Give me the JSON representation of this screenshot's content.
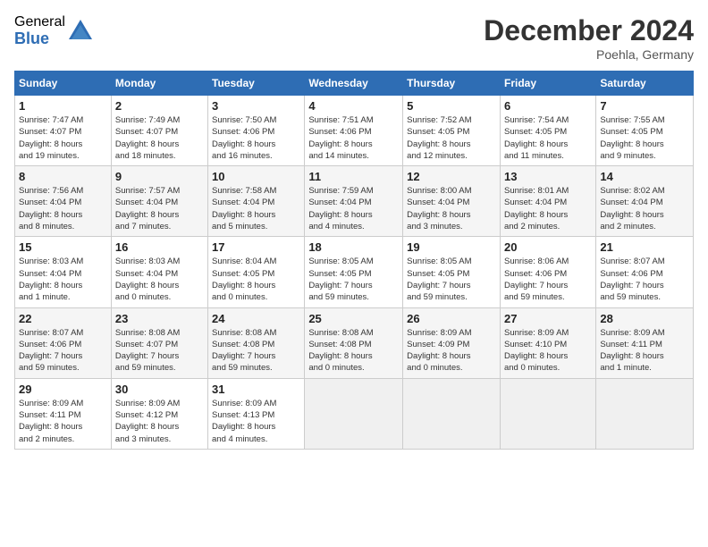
{
  "header": {
    "logo_general": "General",
    "logo_blue": "Blue",
    "month_title": "December 2024",
    "location": "Poehla, Germany"
  },
  "calendar": {
    "days_of_week": [
      "Sunday",
      "Monday",
      "Tuesday",
      "Wednesday",
      "Thursday",
      "Friday",
      "Saturday"
    ],
    "weeks": [
      [
        {
          "day": "1",
          "sunrise": "7:47 AM",
          "sunset": "4:07 PM",
          "daylight": "8 hours and 19 minutes."
        },
        {
          "day": "2",
          "sunrise": "7:49 AM",
          "sunset": "4:07 PM",
          "daylight": "8 hours and 18 minutes."
        },
        {
          "day": "3",
          "sunrise": "7:50 AM",
          "sunset": "4:06 PM",
          "daylight": "8 hours and 16 minutes."
        },
        {
          "day": "4",
          "sunrise": "7:51 AM",
          "sunset": "4:06 PM",
          "daylight": "8 hours and 14 minutes."
        },
        {
          "day": "5",
          "sunrise": "7:52 AM",
          "sunset": "4:05 PM",
          "daylight": "8 hours and 12 minutes."
        },
        {
          "day": "6",
          "sunrise": "7:54 AM",
          "sunset": "4:05 PM",
          "daylight": "8 hours and 11 minutes."
        },
        {
          "day": "7",
          "sunrise": "7:55 AM",
          "sunset": "4:05 PM",
          "daylight": "8 hours and 9 minutes."
        }
      ],
      [
        {
          "day": "8",
          "sunrise": "7:56 AM",
          "sunset": "4:04 PM",
          "daylight": "8 hours and 8 minutes."
        },
        {
          "day": "9",
          "sunrise": "7:57 AM",
          "sunset": "4:04 PM",
          "daylight": "8 hours and 7 minutes."
        },
        {
          "day": "10",
          "sunrise": "7:58 AM",
          "sunset": "4:04 PM",
          "daylight": "8 hours and 5 minutes."
        },
        {
          "day": "11",
          "sunrise": "7:59 AM",
          "sunset": "4:04 PM",
          "daylight": "8 hours and 4 minutes."
        },
        {
          "day": "12",
          "sunrise": "8:00 AM",
          "sunset": "4:04 PM",
          "daylight": "8 hours and 3 minutes."
        },
        {
          "day": "13",
          "sunrise": "8:01 AM",
          "sunset": "4:04 PM",
          "daylight": "8 hours and 2 minutes."
        },
        {
          "day": "14",
          "sunrise": "8:02 AM",
          "sunset": "4:04 PM",
          "daylight": "8 hours and 2 minutes."
        }
      ],
      [
        {
          "day": "15",
          "sunrise": "8:03 AM",
          "sunset": "4:04 PM",
          "daylight": "8 hours and 1 minute."
        },
        {
          "day": "16",
          "sunrise": "8:03 AM",
          "sunset": "4:04 PM",
          "daylight": "8 hours and 0 minutes."
        },
        {
          "day": "17",
          "sunrise": "8:04 AM",
          "sunset": "4:05 PM",
          "daylight": "8 hours and 0 minutes."
        },
        {
          "day": "18",
          "sunrise": "8:05 AM",
          "sunset": "4:05 PM",
          "daylight": "7 hours and 59 minutes."
        },
        {
          "day": "19",
          "sunrise": "8:05 AM",
          "sunset": "4:05 PM",
          "daylight": "7 hours and 59 minutes."
        },
        {
          "day": "20",
          "sunrise": "8:06 AM",
          "sunset": "4:06 PM",
          "daylight": "7 hours and 59 minutes."
        },
        {
          "day": "21",
          "sunrise": "8:07 AM",
          "sunset": "4:06 PM",
          "daylight": "7 hours and 59 minutes."
        }
      ],
      [
        {
          "day": "22",
          "sunrise": "8:07 AM",
          "sunset": "4:06 PM",
          "daylight": "7 hours and 59 minutes."
        },
        {
          "day": "23",
          "sunrise": "8:08 AM",
          "sunset": "4:07 PM",
          "daylight": "7 hours and 59 minutes."
        },
        {
          "day": "24",
          "sunrise": "8:08 AM",
          "sunset": "4:08 PM",
          "daylight": "7 hours and 59 minutes."
        },
        {
          "day": "25",
          "sunrise": "8:08 AM",
          "sunset": "4:08 PM",
          "daylight": "8 hours and 0 minutes."
        },
        {
          "day": "26",
          "sunrise": "8:09 AM",
          "sunset": "4:09 PM",
          "daylight": "8 hours and 0 minutes."
        },
        {
          "day": "27",
          "sunrise": "8:09 AM",
          "sunset": "4:10 PM",
          "daylight": "8 hours and 0 minutes."
        },
        {
          "day": "28",
          "sunrise": "8:09 AM",
          "sunset": "4:11 PM",
          "daylight": "8 hours and 1 minute."
        }
      ],
      [
        {
          "day": "29",
          "sunrise": "8:09 AM",
          "sunset": "4:11 PM",
          "daylight": "8 hours and 2 minutes."
        },
        {
          "day": "30",
          "sunrise": "8:09 AM",
          "sunset": "4:12 PM",
          "daylight": "8 hours and 3 minutes."
        },
        {
          "day": "31",
          "sunrise": "8:09 AM",
          "sunset": "4:13 PM",
          "daylight": "8 hours and 4 minutes."
        },
        null,
        null,
        null,
        null
      ]
    ]
  }
}
